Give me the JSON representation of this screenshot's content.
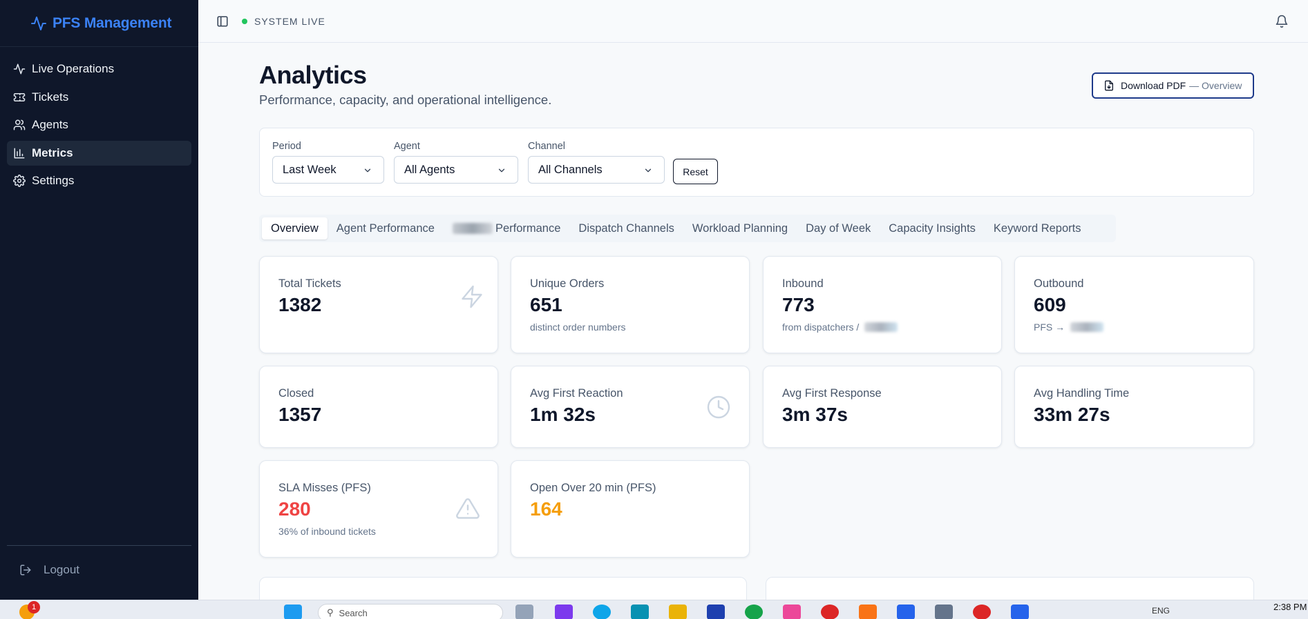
{
  "brand": {
    "name": "PFS Management",
    "icon": "activity-icon"
  },
  "sidebar": {
    "items": [
      {
        "label": "Live Operations",
        "icon": "activity-icon",
        "active": false
      },
      {
        "label": "Tickets",
        "icon": "ticket-icon",
        "active": false
      },
      {
        "label": "Agents",
        "icon": "users-icon",
        "active": false
      },
      {
        "label": "Metrics",
        "icon": "bar-chart-icon",
        "active": true
      },
      {
        "label": "Settings",
        "icon": "gear-icon",
        "active": false
      }
    ],
    "logout_label": "Logout"
  },
  "topbar": {
    "status_text": "SYSTEM LIVE",
    "status_color": "#22c55e"
  },
  "header": {
    "title": "Analytics",
    "subtitle": "Performance, capacity, and operational intelligence.",
    "download_label": "Download PDF",
    "download_suffix": "— Overview"
  },
  "filters": {
    "period": {
      "label": "Period",
      "value": "Last Week"
    },
    "agent": {
      "label": "Agent",
      "value": "All Agents"
    },
    "channel": {
      "label": "Channel",
      "value": "All Channels"
    },
    "reset_label": "Reset"
  },
  "tabs": [
    {
      "label": "Overview",
      "active": true
    },
    {
      "label": "Agent Performance",
      "active": false
    },
    {
      "label": "Performance",
      "active": false,
      "redacted_prefix": true
    },
    {
      "label": "Dispatch Channels",
      "active": false
    },
    {
      "label": "Workload Planning",
      "active": false
    },
    {
      "label": "Day of Week",
      "active": false
    },
    {
      "label": "Capacity Insights",
      "active": false
    },
    {
      "label": "Keyword Reports",
      "active": false
    }
  ],
  "cards": {
    "total_tickets": {
      "label": "Total Tickets",
      "value": "1382",
      "icon": "lightning-icon"
    },
    "unique_orders": {
      "label": "Unique Orders",
      "value": "651",
      "sub": "distinct order numbers"
    },
    "inbound": {
      "label": "Inbound",
      "value": "773",
      "sub": "from dispatchers /"
    },
    "outbound": {
      "label": "Outbound",
      "value": "609",
      "sub": "PFS →"
    },
    "closed": {
      "label": "Closed",
      "value": "1357"
    },
    "avg_first_reaction": {
      "label": "Avg First Reaction",
      "value": "1m 32s",
      "icon": "clock-icon"
    },
    "avg_first_response": {
      "label": "Avg First Response",
      "value": "3m 37s"
    },
    "avg_handling_time": {
      "label": "Avg Handling Time",
      "value": "33m 27s"
    },
    "sla_misses": {
      "label": "SLA Misses (PFS)",
      "value": "280",
      "sub": "36% of inbound tickets",
      "icon": "warning-icon",
      "value_color": "#ef4444"
    },
    "open_over_20": {
      "label": "Open Over 20 min (PFS)",
      "value": "164",
      "value_color": "#f59e0b"
    }
  },
  "taskbar": {
    "search_placeholder": "Search",
    "language": "ENG",
    "clock": "2:38 PM",
    "notification_count": "1"
  }
}
